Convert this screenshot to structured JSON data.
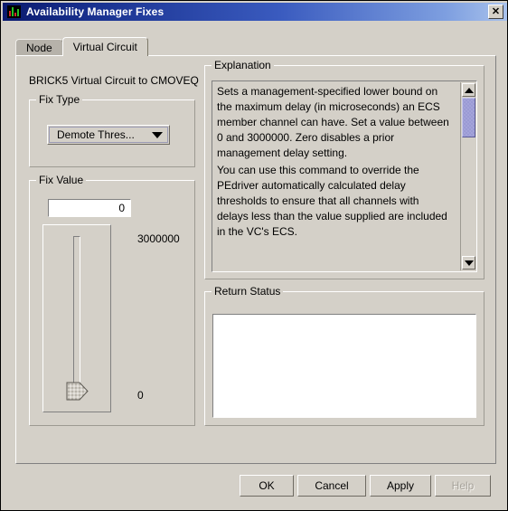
{
  "window": {
    "title": "Availability Manager Fixes",
    "icon": "bar-chart-icon",
    "close_label": "✕"
  },
  "tabs": [
    {
      "label": "Node",
      "active": false
    },
    {
      "label": "Virtual Circuit",
      "active": true
    }
  ],
  "content": {
    "context_label": "BRICK5 Virtual Circuit to CMOVEQ"
  },
  "fix_type": {
    "group_label": "Fix Type",
    "selected": "Demote Thres...",
    "arrow_icon": "chevron-down-icon"
  },
  "fix_value": {
    "group_label": "Fix Value",
    "value": "0",
    "slider_max_label": "3000000",
    "slider_min_label": "0",
    "slider_position": "min"
  },
  "explanation": {
    "group_label": "Explanation",
    "paragraphs": [
      "Sets a management-specified lower bound on the maximum delay (in microseconds) an ECS member channel can have. Set a value between 0 and 3000000. Zero disables a prior management delay setting.",
      "You can use this command to override the PEdriver automatically calculated delay thresholds to ensure that all channels with delays less than the value supplied are included in the VC's ECS."
    ],
    "scrollbar": {
      "up_icon": "triangle-up-icon",
      "down_icon": "triangle-down-icon",
      "thumb_color": "#9a9ad4"
    }
  },
  "return_status": {
    "group_label": "Return Status",
    "text": ""
  },
  "buttons": [
    {
      "label": "OK",
      "enabled": true
    },
    {
      "label": "Cancel",
      "enabled": true
    },
    {
      "label": "Apply",
      "enabled": true
    },
    {
      "label": "Help",
      "enabled": false
    }
  ],
  "colors": {
    "face": "#d4d0c8",
    "title_dark": "#0a1a6e",
    "title_light": "#a9c2ec",
    "scroll_thumb": "#9a9ad4"
  }
}
